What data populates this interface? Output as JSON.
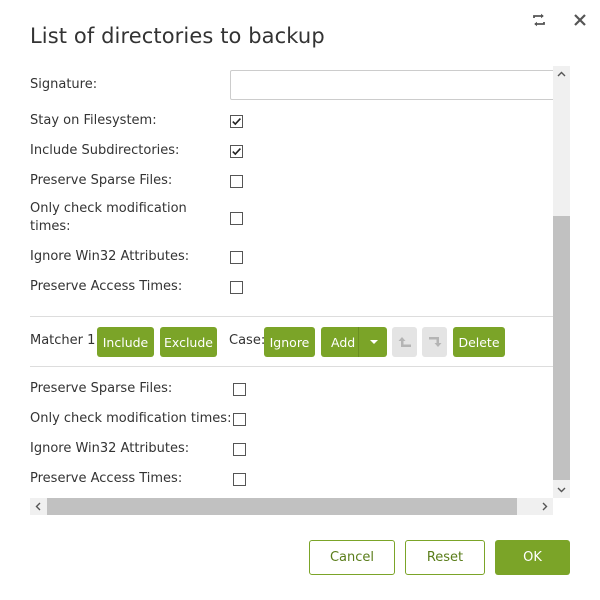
{
  "dialog": {
    "title": "List of directories to backup",
    "accent_color": "#7ba428"
  },
  "icons": {
    "refresh": "refresh-icon",
    "close": "close-icon"
  },
  "form": {
    "signature": {
      "label": "Signature:",
      "value": ""
    },
    "options": [
      {
        "label": "Stay on Filesystem:",
        "checked": true
      },
      {
        "label": "Include Subdirectories:",
        "checked": true
      },
      {
        "label": "Preserve Sparse Files:",
        "checked": false
      },
      {
        "label": "Only check modification times:",
        "checked": false
      },
      {
        "label": "Ignore Win32 Attributes:",
        "checked": false
      },
      {
        "label": "Preserve Access Times:",
        "checked": false
      }
    ]
  },
  "matcher": {
    "label": "Matcher 1",
    "include_label": "Include",
    "exclude_label": "Exclude",
    "case_label": "Case:",
    "ignore_label": "Ignore",
    "add_label": "Add",
    "delete_label": "Delete",
    "options": [
      {
        "label": "Preserve Sparse Files:",
        "checked": false
      },
      {
        "label": "Only check modification times:",
        "checked": false
      },
      {
        "label": "Ignore Win32 Attributes:",
        "checked": false
      },
      {
        "label": "Preserve Access Times:",
        "checked": false
      }
    ]
  },
  "footer": {
    "cancel_label": "Cancel",
    "reset_label": "Reset",
    "ok_label": "OK"
  }
}
